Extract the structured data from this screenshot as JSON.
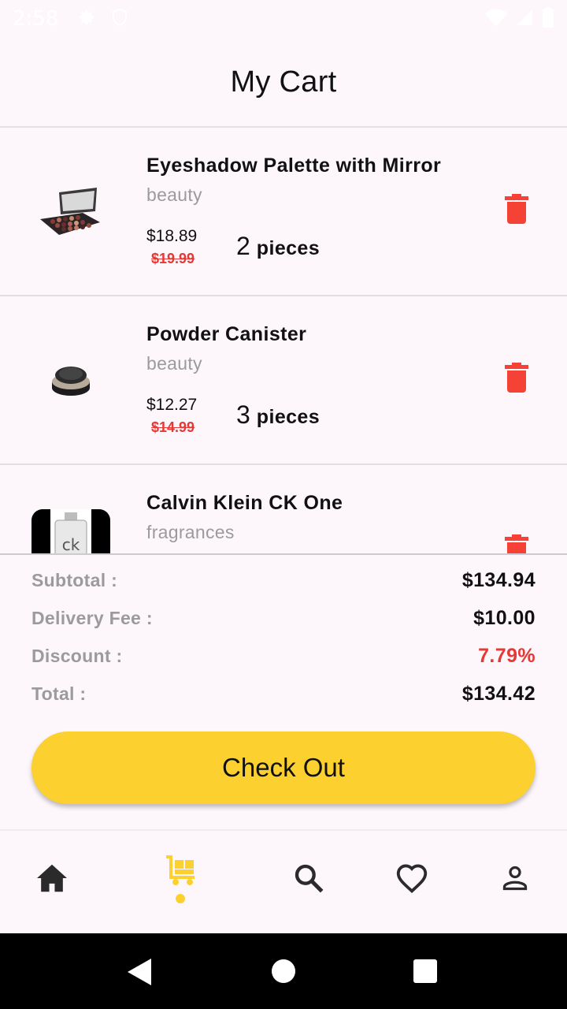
{
  "status_bar": {
    "time": "2:58",
    "icons": [
      "gear-icon",
      "shield-icon",
      "wifi-icon",
      "signal-icon",
      "battery-icon"
    ]
  },
  "app_bar": {
    "title": "My Cart"
  },
  "cart": {
    "items": [
      {
        "name": "Eyeshadow Palette with Mirror",
        "category": "beauty",
        "price": "$18.89",
        "old_price": "$19.99",
        "quantity": "2",
        "unit": "pieces",
        "thumbnail": "eyeshadow-palette-image"
      },
      {
        "name": "Powder Canister",
        "category": "beauty",
        "price": "$12.27",
        "old_price": "$14.99",
        "quantity": "3",
        "unit": "pieces",
        "thumbnail": "powder-canister-image"
      },
      {
        "name": "Calvin Klein CK One",
        "category": "fragrances",
        "price": "",
        "old_price": "",
        "quantity": "",
        "unit": "",
        "thumbnail": "perfume-bottle-image"
      }
    ]
  },
  "summary": {
    "subtotal_label": "Subtotal :",
    "subtotal_value": "$134.94",
    "delivery_label": "Delivery Fee :",
    "delivery_value": "$10.00",
    "discount_label": "Discount :",
    "discount_value": "7.79%",
    "total_label": "Total :",
    "total_value": "$134.42"
  },
  "checkout": {
    "label": "Check Out"
  },
  "bottom_nav": {
    "items": [
      "home-icon",
      "cart-icon",
      "search-icon",
      "heart-icon",
      "person-icon"
    ],
    "active": "cart-icon"
  },
  "colors": {
    "accent": "#fcd02e",
    "delete": "#f44336",
    "strike_price": "#e53935",
    "muted": "#9b9b9b",
    "background": "#fdf7fc"
  }
}
